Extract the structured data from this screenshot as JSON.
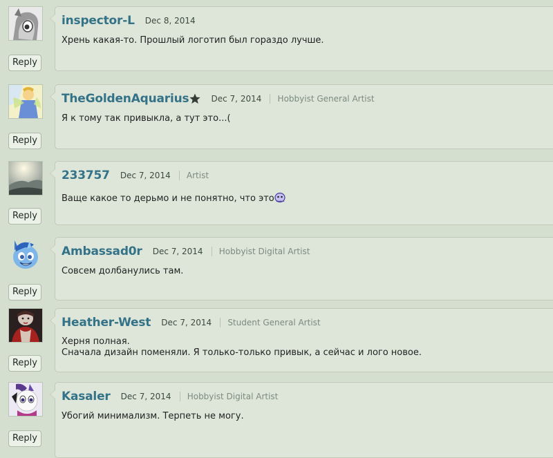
{
  "reply_label": "Reply",
  "comments": [
    {
      "username": "inspector-L",
      "date": "Dec 8, 2014",
      "role": "",
      "lines": [
        "Хрень какая-то. Прошлый логотип был гораздо лучше."
      ],
      "avatar_icon": "gray-pony-avatar-icon"
    },
    {
      "username": "TheGoldenAquarius",
      "date": "Dec 7, 2014",
      "role": "Hobbyist General Artist",
      "lines": [
        "Я к тому так привыкла, а тут это...("
      ],
      "avatar_icon": "fairy-avatar-icon",
      "badge_icon": "star-icon"
    },
    {
      "username": "233757",
      "date": "Dec 7, 2014",
      "role": "Artist",
      "lines": [
        "Ваще какое то дерьмо и не понятно, что это"
      ],
      "avatar_icon": "landscape-avatar-icon",
      "emote_icon": "blob-emoticon-icon"
    },
    {
      "username": "Ambassad0r",
      "date": "Dec 7, 2014",
      "role": "Hobbyist Digital Artist",
      "lines": [
        "Совсем долбанулись там."
      ],
      "avatar_icon": "blue-pony-avatar-icon"
    },
    {
      "username": "Heather-West",
      "date": "Dec 7, 2014",
      "role": "Student General Artist",
      "lines": [
        "Херня полная.",
        "Сначала дизайн поменяли. Я только-только привык, а сейчас и лого новое."
      ],
      "avatar_icon": "portrait-avatar-icon"
    },
    {
      "username": "Kasaler",
      "date": "Dec 7, 2014",
      "role": "Hobbyist Digital Artist",
      "lines": [
        "Убогий минимализм. Терпеть не могу."
      ],
      "avatar_icon": "white-pony-avatar-icon"
    }
  ]
}
